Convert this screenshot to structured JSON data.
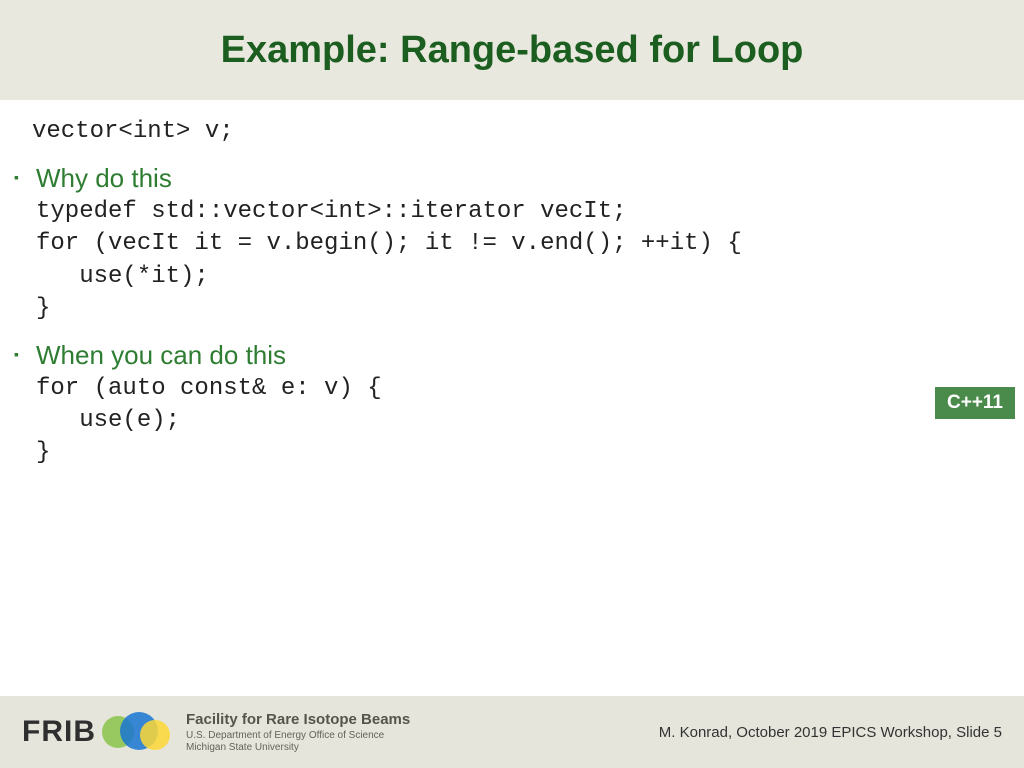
{
  "title": "Example: Range-based for Loop",
  "intro_code": "vector<int> v;",
  "section1": {
    "heading": "Why do this",
    "code": "typedef std::vector<int>::iterator vecIt;\nfor (vecIt it = v.begin(); it != v.end(); ++it) {\n   use(*it);\n}"
  },
  "section2": {
    "heading": "When you can do this",
    "code": "for (auto const& e: v) {\n   use(e);\n}"
  },
  "badge": "C++11",
  "footer": {
    "frib": "FRIB",
    "facility_name": "Facility for Rare Isotope Beams",
    "facility_sub1": "U.S. Department of Energy Office of Science",
    "facility_sub2": "Michigan State University",
    "right": "M. Konrad, October 2019 EPICS Workshop, Slide 5"
  }
}
